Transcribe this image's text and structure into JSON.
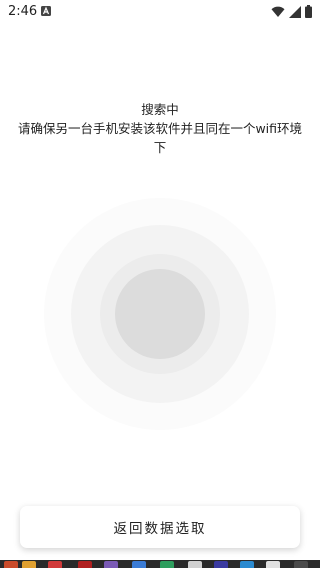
{
  "status_bar": {
    "time": "2:46",
    "icons": [
      "a-notification-icon",
      "wifi-icon",
      "signal-icon",
      "battery-icon"
    ]
  },
  "message": {
    "title": "搜索中",
    "line1": "请确保另一台手机安装该软件并且同在一个wifi环境",
    "line2": "下"
  },
  "back_button": {
    "label": "返回数据选取"
  },
  "colors": {
    "background": "#ffffff",
    "text": "#222222",
    "pulse_core": "#dcdcdc",
    "pulse_ring_inner": "#ececec",
    "pulse_ring_mid": "#f3f3f3",
    "pulse_ring_outer": "#fbfbfb",
    "taskbar": "#2a2a2a"
  }
}
